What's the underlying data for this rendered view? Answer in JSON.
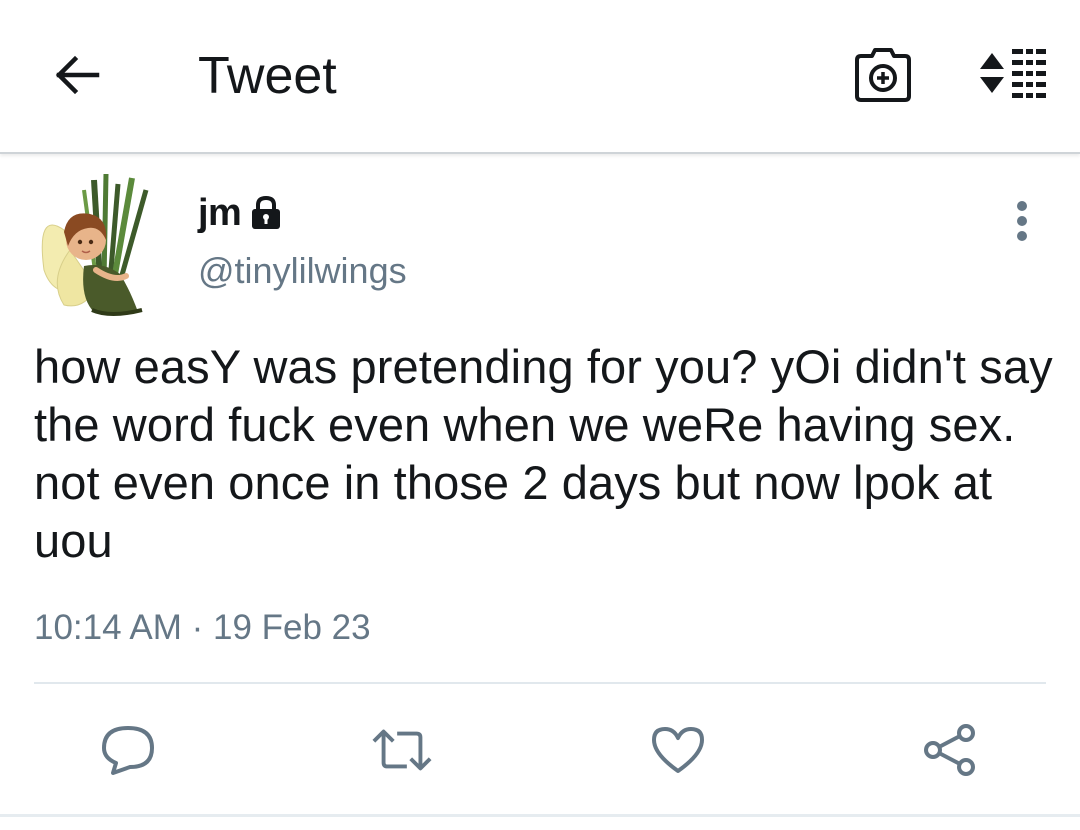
{
  "appbar": {
    "title": "Tweet",
    "back_icon": "arrow-left-icon",
    "camera_icon": "camera-plus-icon",
    "sort_icon": "sort-lines-icon"
  },
  "tweet": {
    "display_name": "jm",
    "protected_icon": "lock-icon",
    "handle": "@tinylilwings",
    "text": "how easY was pretending for you? yOi didn't say the word fuck even when we weRe having sex. not even once in those 2 days but now lpok at uou",
    "timestamp": "10:14 AM · 19 Feb 23",
    "more_icon": "more-vertical-icon"
  },
  "actions": [
    {
      "name": "reply",
      "icon": "reply-bubble-icon"
    },
    {
      "name": "retweet",
      "icon": "retweet-icon"
    },
    {
      "name": "like",
      "icon": "heart-icon"
    },
    {
      "name": "share",
      "icon": "share-icon"
    }
  ],
  "colors": {
    "text_primary": "#14171a",
    "text_secondary": "#657786",
    "icon_gray": "#657786",
    "divider": "#e1e8ed"
  }
}
